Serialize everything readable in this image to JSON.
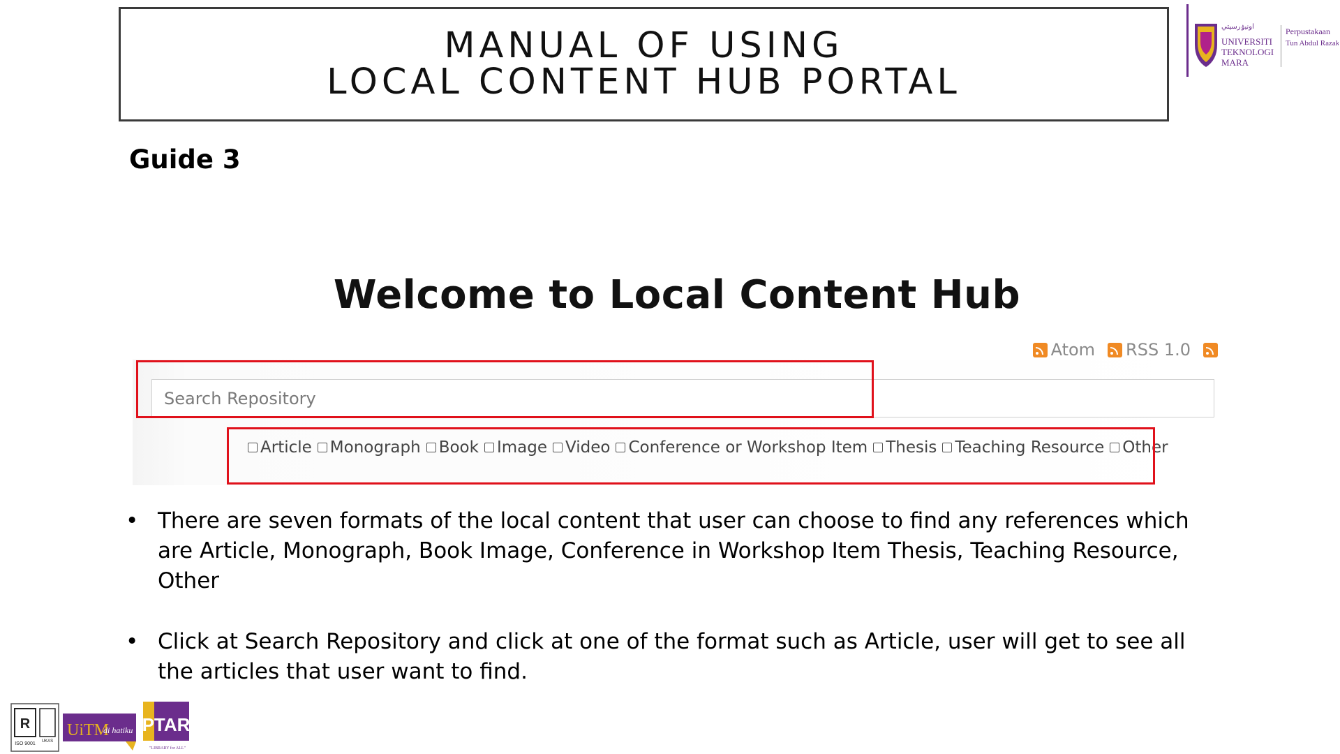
{
  "slide": {
    "title_line1": "MANUAL OF USING",
    "title_line2": "LOCAL CONTENT HUB PORTAL",
    "guide_label": "Guide 3"
  },
  "logo": {
    "university_name_line1": "UNIVERSITI",
    "university_name_line2": "TEKNOLOGI",
    "university_name_line3": "MARA",
    "library_line1": "Perpustakaan",
    "library_line2": "Tun Abdul Razak"
  },
  "portal": {
    "heading": "Welcome to Local Content Hub",
    "feeds": [
      {
        "label": "Atom"
      },
      {
        "label": "RSS 1.0"
      },
      {
        "label": ""
      }
    ],
    "search_placeholder": "Search Repository",
    "formats": [
      "Article",
      "Monograph",
      "Book",
      "Image",
      "Video",
      "Conference or Workshop Item",
      "Thesis",
      "Teaching Resource",
      "Other"
    ]
  },
  "bullets": [
    "There are seven formats of the local content that user can choose to find any references  which are Article, Monograph, Book Image, Conference in Workshop Item Thesis, Teaching Resource, Other",
    "Click at Search Repository  and  click at one of the format such as Article, user will get to see all the articles that user want to find."
  ],
  "footer": {
    "iso_text": "ISO 9001",
    "ukas_text": "UKAS",
    "uitm_text": "UiTM",
    "uitm_tagline": "di hatiku",
    "ptar_text": "PTAR",
    "ptar_tagline": "\"LIBRARY for ALL\""
  },
  "colors": {
    "highlight_red": "#e0111b",
    "rss_orange": "#f08a24",
    "uitm_purple": "#6b2d8c",
    "uitm_gold": "#e8b41e"
  }
}
